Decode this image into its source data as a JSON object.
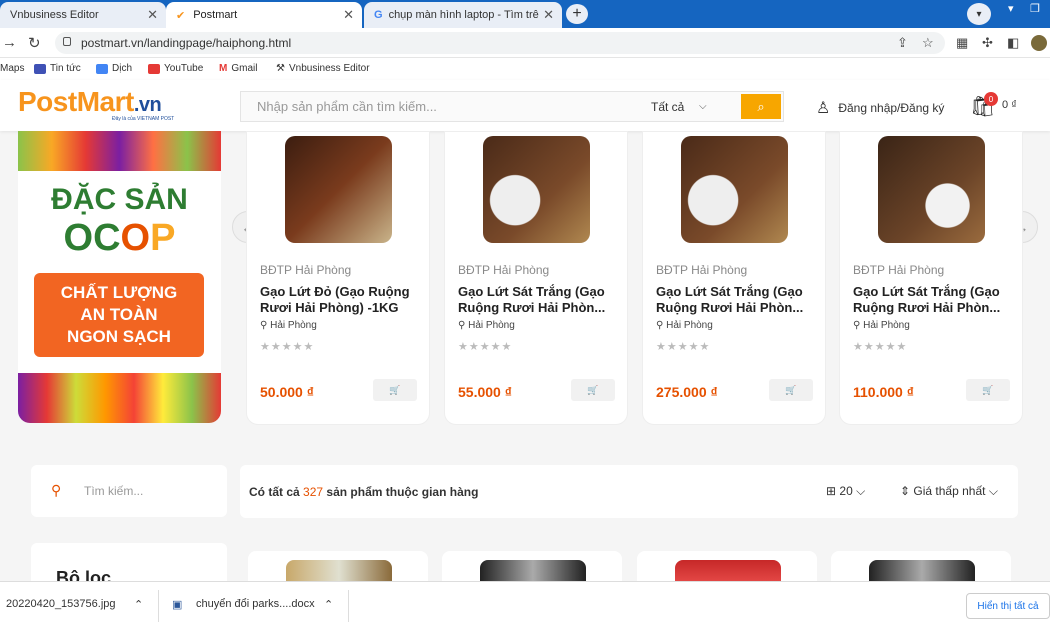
{
  "browser": {
    "tabs": [
      {
        "title": "Vnbusiness Editor",
        "active": false
      },
      {
        "title": "Postmart",
        "active": true
      },
      {
        "title": "chụp màn hình laptop - Tìm trên",
        "active": false
      }
    ],
    "url": "postmart.vn/landingpage/haiphong.html",
    "bookmarks": [
      "Maps",
      "Tin tức",
      "Dịch",
      "YouTube",
      "Gmail",
      "Vnbusiness Editor"
    ]
  },
  "header": {
    "logo_post": "Post",
    "logo_mart": "Mart",
    "logo_vn": ".vn",
    "logo_sub": "Đây là của VIETNAM POST",
    "search_placeholder": "Nhập sản phẩm cần tìm kiếm...",
    "category": "Tất cả",
    "login": "Đăng nhập/Đăng ký",
    "cart_count": "0",
    "cart_amount": "0 ₫"
  },
  "banner": {
    "line1": "ĐẶC SẢN",
    "line2_oc": "OC",
    "line2_o": "O",
    "line2_p": "P",
    "box": [
      "CHẤT LƯỢNG",
      "AN TOÀN",
      "NGON SẠCH"
    ]
  },
  "products": [
    {
      "seller": "BĐTP Hải Phòng",
      "name": "Gạo Lứt Đỏ (Gạo Ruộng Rươi Hải Phòng) -1KG",
      "location": "Hải Phòng",
      "price": "50.000 ₫"
    },
    {
      "seller": "BĐTP Hải Phòng",
      "name": "Gạo Lứt Sát Trắng (Gạo Ruộng Rươi Hải Phòn...",
      "location": "Hải Phòng",
      "price": "55.000 ₫"
    },
    {
      "seller": "BĐTP Hải Phòng",
      "name": "Gạo Lứt Sát Trắng (Gạo Ruộng Rươi Hải Phòn...",
      "location": "Hải Phòng",
      "price": "275.000 ₫"
    },
    {
      "seller": "BĐTP Hải Phòng",
      "name": "Gạo Lứt Sát Trắng (Gạo Ruộng Rươi Hải Phòn...",
      "location": "Hải Phòng",
      "price": "110.000 ₫"
    }
  ],
  "listing": {
    "search_placeholder": "Tìm kiếm...",
    "count_prefix": "Có tất cả",
    "count": "327",
    "count_suffix": "sản phẩm thuộc gian hàng",
    "per_page": "20",
    "sort": "Giá thấp nhất",
    "filter_title": "Bộ lọc"
  },
  "downloads": {
    "file1": "20220420_153756.jpg",
    "file2": "chuyển đổi parks....docx",
    "show_all": "Hiển thị tất cả"
  },
  "colors": {
    "accent": "#f7941d",
    "price": "#e65100",
    "chrome": "#1565c0"
  }
}
